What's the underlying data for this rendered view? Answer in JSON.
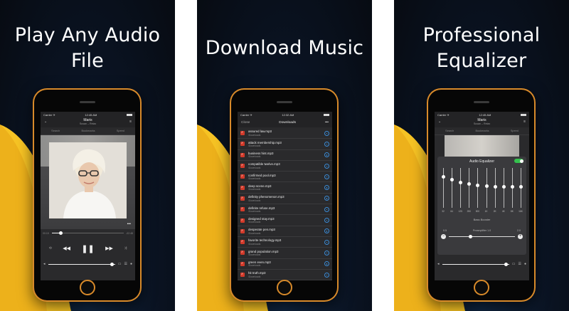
{
  "panels": [
    {
      "headline_lines": [
        "Play Any Audio",
        "File"
      ],
      "status": {
        "carrier": "Carrier ✈",
        "time": "12:45 AM"
      },
      "now_playing": {
        "title": "Maris",
        "subtitle": "Susan – Relax"
      },
      "tabs": [
        "Search",
        "Bookmarks",
        "Speed"
      ],
      "timeline": {
        "elapsed": "00:15",
        "remaining": "-02:48",
        "progress": 0.12
      },
      "volume": 0.95
    },
    {
      "headline_lines": [
        "Download Music"
      ],
      "status": {
        "carrier": "Carrier ✈",
        "time": "12:32 AM"
      },
      "header": {
        "close": "Close",
        "title": "Downloads",
        "more": "•••"
      },
      "files": [
        {
          "name": "assured law.mp3",
          "path": "/Downloads"
        },
        {
          "name": "attack membership.mp3",
          "path": "/Downloads"
        },
        {
          "name": "business hint.mp3",
          "path": "/Downloads"
        },
        {
          "name": "compatible twelve.mp3",
          "path": "/Downloads"
        },
        {
          "name": "confirmed pool.mp3",
          "path": "/Downloads"
        },
        {
          "name": "deep scene.mp3",
          "path": "/Downloads"
        },
        {
          "name": "definity phenomenon.mp3",
          "path": "/Downloads"
        },
        {
          "name": "definite refuse.mp3",
          "path": "/Downloads"
        },
        {
          "name": "designed stay.mp3",
          "path": "/Downloads"
        },
        {
          "name": "desperate pen.mp3",
          "path": "/Downloads"
        },
        {
          "name": "favorite technology.mp3",
          "path": "/Downloads"
        },
        {
          "name": "grand population.mp3",
          "path": "/Downloads"
        },
        {
          "name": "green even.mp3",
          "path": "/Downloads"
        },
        {
          "name": "hit truth.mp3",
          "path": "/Downloads"
        }
      ]
    },
    {
      "headline_lines": [
        "Professional",
        "Equalizer"
      ],
      "status": {
        "carrier": "Carrier ✈",
        "time": "12:45 AM"
      },
      "now_playing": {
        "title": "Maris",
        "subtitle": "Susan – Relax"
      },
      "tabs": [
        "Search",
        "Bookmarks",
        "Speed"
      ],
      "eq": {
        "title": "Audio Equalizer",
        "enabled": true,
        "bands": [
          {
            "label": "32",
            "level": 0.22
          },
          {
            "label": "64",
            "level": 0.3
          },
          {
            "label": "125",
            "level": 0.36
          },
          {
            "label": "250",
            "level": 0.4
          },
          {
            "label": "500",
            "level": 0.44
          },
          {
            "label": "1K",
            "level": 0.46
          },
          {
            "label": "2K",
            "level": 0.48
          },
          {
            "label": "4K",
            "level": 0.48
          },
          {
            "label": "8K",
            "level": 0.48
          },
          {
            "label": "16K",
            "level": 0.48
          }
        ],
        "bass_label": "Bass Booster",
        "preamp_label": "Preamplifier 1.0",
        "preamp_min": "0.5",
        "preamp_max": "2.0",
        "preamp_level": 0.33
      }
    }
  ],
  "colors": {
    "phone_frame": "#d88a2a",
    "swoosh": "#f6c324",
    "accent_blue": "#3a8bd6",
    "toggle_green": "#35c24e"
  },
  "icons": [
    "chevron-down-icon",
    "menu-icon",
    "repeat-icon",
    "rewind-icon",
    "pause-icon",
    "forward-icon",
    "shuffle-icon",
    "volume-icon",
    "airplay-icon",
    "playlist-icon",
    "more-icon",
    "music-file-icon",
    "download-button-icon"
  ]
}
